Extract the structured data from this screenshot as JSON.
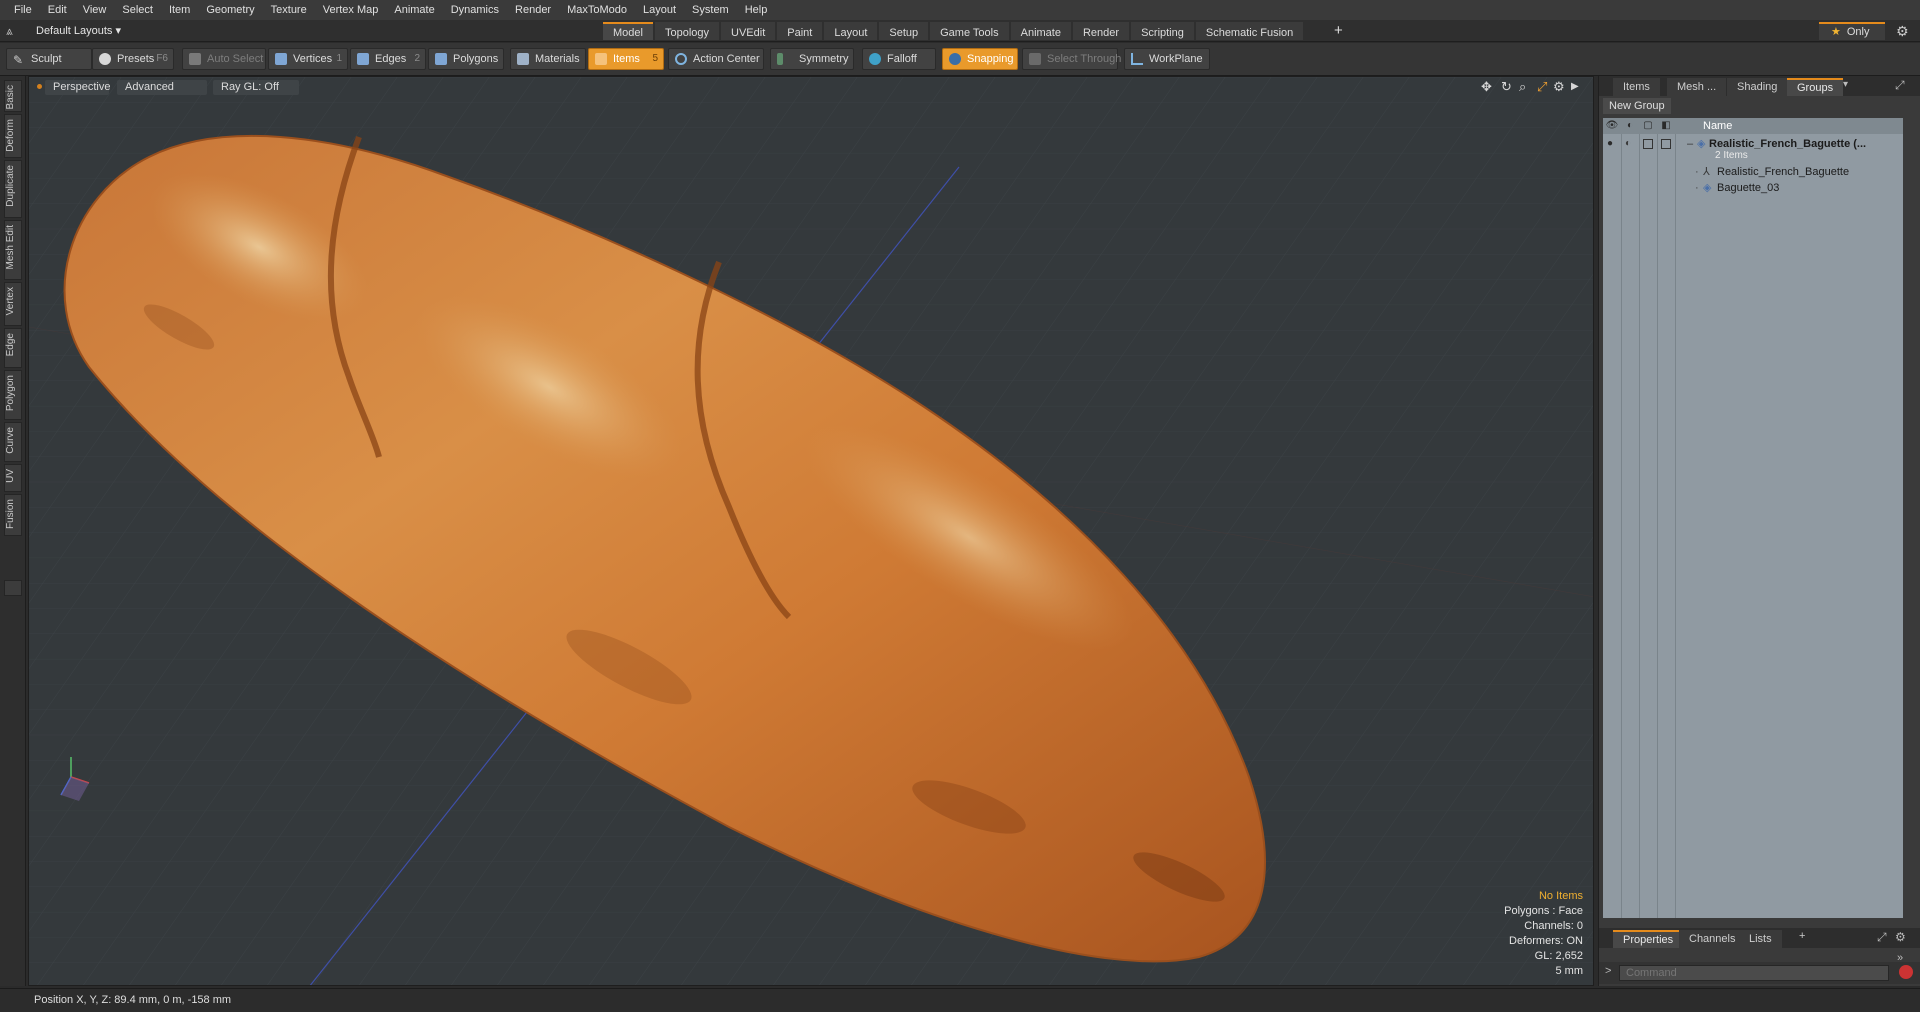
{
  "menu": [
    "File",
    "Edit",
    "View",
    "Select",
    "Item",
    "Geometry",
    "Texture",
    "Vertex Map",
    "Animate",
    "Dynamics",
    "Render",
    "MaxToModo",
    "Layout",
    "System",
    "Help"
  ],
  "layouts": {
    "label": "Default Layouts"
  },
  "tabs": [
    {
      "label": "Model",
      "active": true
    },
    {
      "label": "Topology"
    },
    {
      "label": "UVEdit"
    },
    {
      "label": "Paint"
    },
    {
      "label": "Layout"
    },
    {
      "label": "Setup"
    },
    {
      "label": "Game Tools"
    },
    {
      "label": "Animate"
    },
    {
      "label": "Render"
    },
    {
      "label": "Scripting"
    },
    {
      "label": "Schematic Fusion"
    }
  ],
  "tab_add": "+",
  "only_label": "Only",
  "toolbar": {
    "sculpt": "Sculpt",
    "presets": "Presets",
    "presets_key": "F6",
    "auto_select": "Auto Select",
    "vertices": "Vertices",
    "vertices_count": "1",
    "edges": "Edges",
    "edges_count": "2",
    "polygons": "Polygons",
    "materials": "Materials",
    "items": "Items",
    "items_count": "5",
    "action_center": "Action Center",
    "symmetry": "Symmetry",
    "falloff": "Falloff",
    "snapping": "Snapping",
    "select_through": "Select Through",
    "workplane": "WorkPlane"
  },
  "left_tabs": [
    "Basic",
    "Deform",
    "Duplicate",
    "Mesh Edit",
    "Vertex",
    "Edge",
    "Polygon",
    "Curve",
    "UV",
    "Fusion"
  ],
  "viewport": {
    "view": "Perspective",
    "shading": "Advanced",
    "raygl": "Ray GL: Off",
    "stats": {
      "selection": "No Items",
      "polygons": "Polygons : Face",
      "channels": "Channels: 0",
      "deformers": "Deformers: ON",
      "gl": "GL: 2,652",
      "unit": "5 mm"
    }
  },
  "right_panel": {
    "tabs": [
      "Items",
      "Mesh ...",
      "Shading",
      "Groups"
    ],
    "active_tab": "Groups",
    "new_group": "New Group",
    "name_header": "Name",
    "tree": {
      "group_name": "Realistic_French_Baguette (...",
      "group_count": "2 Items",
      "child1": "Realistic_French_Baguette",
      "child2": "Baguette_03"
    },
    "bottom_tabs": [
      "Properties",
      "Channels",
      "Lists"
    ],
    "bottom_active": "Properties",
    "command_placeholder": "Command"
  },
  "status": {
    "position": "Position X, Y, Z:  89.4 mm, 0 m, -158 mm"
  },
  "colors": {
    "accent": "#e58b1c",
    "viewport_bg": "#34393c",
    "bread": "#d2813a"
  }
}
